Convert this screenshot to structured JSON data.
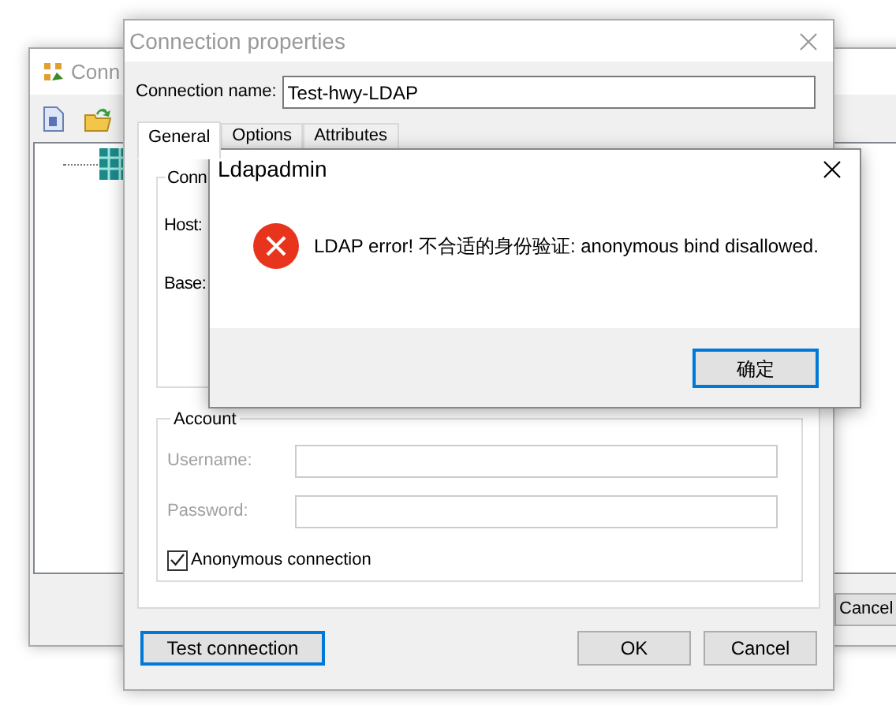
{
  "background_window": {
    "title": "Conn",
    "buttons": [
      "Cancel"
    ]
  },
  "connection_window": {
    "title": "Connection properties",
    "name_label": "Connection name:",
    "name_value": "Test-hwy-LDAP",
    "tabs": [
      {
        "label": "General",
        "selected": true
      },
      {
        "label": "Options",
        "selected": false
      },
      {
        "label": "Attributes",
        "selected": false
      }
    ],
    "connection_group": {
      "title": "Conn",
      "fields": [
        {
          "label": "Host:"
        },
        {
          "label": "Base:"
        }
      ]
    },
    "account_group": {
      "title": "Account",
      "fields": [
        {
          "label": "Username:",
          "disabled": true
        },
        {
          "label": "Password:",
          "disabled": true
        }
      ],
      "anonymous": {
        "label": "Anonymous connection",
        "checked": true
      }
    },
    "buttons": [
      {
        "label": "Test connection",
        "focused": true
      },
      {
        "label": "OK",
        "focused": false
      },
      {
        "label": "Cancel",
        "focused": false
      }
    ]
  },
  "message_box": {
    "title": "Ldapadmin",
    "message": "LDAP error! 不合适的身份验证: anonymous bind disallowed.",
    "button": {
      "label": "确定",
      "focused": true
    }
  }
}
